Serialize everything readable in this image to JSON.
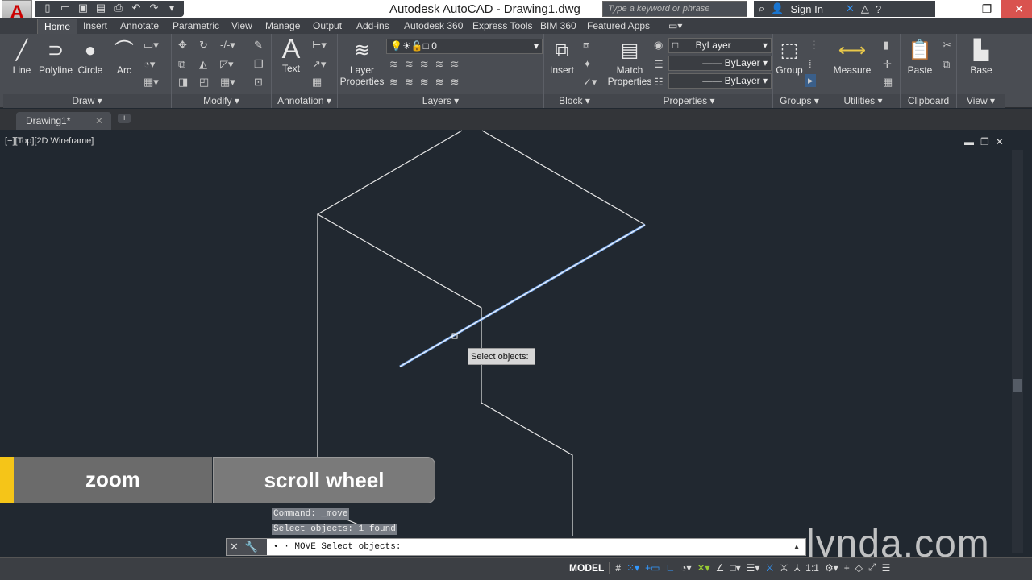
{
  "titlebar": {
    "title": "Autodesk AutoCAD - Drawing1.dwg",
    "search_placeholder": "Type a keyword or phrase",
    "sign_in": "Sign In"
  },
  "tabs": [
    "Home",
    "Insert",
    "Annotate",
    "Parametric",
    "View",
    "Manage",
    "Output",
    "Add-ins",
    "Autodesk 360",
    "Express Tools",
    "BIM 360",
    "Featured Apps"
  ],
  "ribbon": {
    "draw": {
      "label": "Draw",
      "tools": [
        "Line",
        "Polyline",
        "Circle",
        "Arc"
      ]
    },
    "modify": {
      "label": "Modify"
    },
    "annotation": {
      "label": "Annotation",
      "text": "Text"
    },
    "layers": {
      "label": "Layers",
      "layer_properties": "Layer Properties",
      "current_layer": "0"
    },
    "block": {
      "label": "Block",
      "insert": "Insert"
    },
    "properties": {
      "label": "Properties",
      "match": "Match Properties",
      "color": "ByLayer",
      "linetype": "ByLayer",
      "lineweight": "ByLayer"
    },
    "groups": {
      "label": "Groups",
      "group": "Group"
    },
    "utilities": {
      "label": "Utilities",
      "measure": "Measure"
    },
    "clipboard": {
      "label": "Clipboard",
      "paste": "Paste"
    },
    "view": {
      "label": "View",
      "base": "Base"
    }
  },
  "doc_tab": "Drawing1*",
  "viewport_label": "[−][Top][2D Wireframe]",
  "tooltip": "Select objects:",
  "overlay": {
    "key1": "zoom",
    "key2": "scroll wheel",
    "accent": "#f5c518"
  },
  "command": {
    "history": [
      "Command: _move",
      "Select objects: 1 found"
    ],
    "prompt": "• · MOVE Select objects:"
  },
  "watermark": "lynda.com",
  "statusbar": {
    "model": "MODEL",
    "scale": "1:1"
  }
}
